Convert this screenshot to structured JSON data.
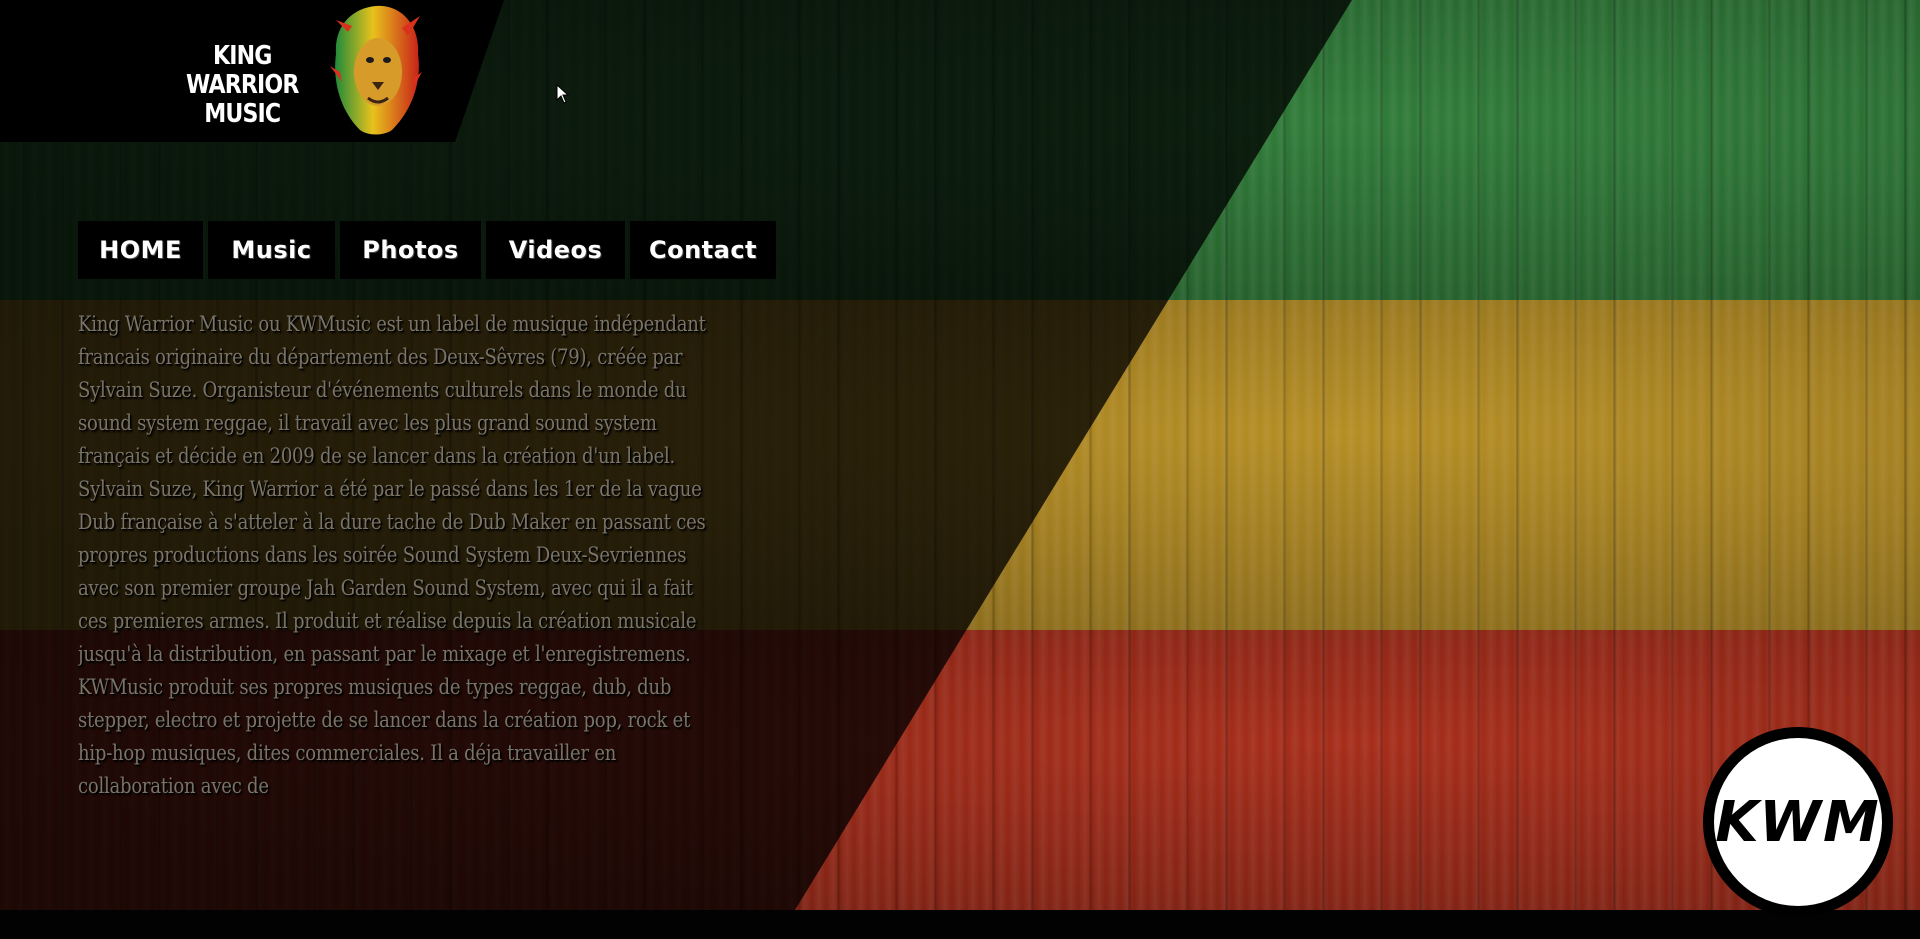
{
  "logo": {
    "line1": "KING WARRIOR",
    "line2": "MUSIC"
  },
  "nav": {
    "items": [
      {
        "label": "HOME"
      },
      {
        "label": "Music"
      },
      {
        "label": "Photos"
      },
      {
        "label": "Videos"
      },
      {
        "label": "Contact"
      }
    ]
  },
  "content": {
    "text": "King Warrior Music ou KWMusic est un label de musique indépendant francais originaire du département des Deux-Sêvres (79), créée par Sylvain Suze. Organisteur d'événements culturels dans le monde du sound system reggae, il travail avec les plus grand sound system français et décide en 2009 de se lancer dans la création d'un label. Sylvain Suze, King Warrior a été par le passé dans les 1er de la vague Dub française à s'atteler à la dure tache de Dub Maker en passant ces propres productions dans les soirée Sound System Deux-Sevriennes avec son premier groupe Jah Garden Sound System, avec qui il a fait ces premieres armes. Il produit et réalise depuis la création musicale jusqu'à la distribution, en passant par le mixage et l'enregistremens. KWMusic produit ses propres musiques de types reggae, dub, dub stepper, electro et projette de se lancer dans la création pop, rock et hip-hop musiques, dites commerciales. Il a déja travailler en collaboration avec de"
  },
  "badge": {
    "label": "KWM"
  },
  "colors": {
    "green": "#2f7b38",
    "yellow": "#b58d23",
    "red": "#a62c19"
  }
}
